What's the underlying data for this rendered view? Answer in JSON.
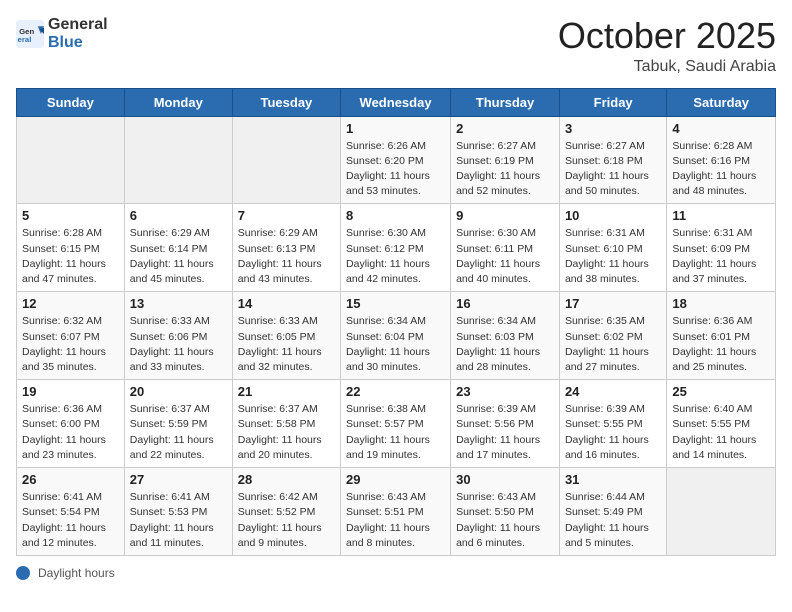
{
  "header": {
    "logo_general": "General",
    "logo_blue": "Blue",
    "month": "October 2025",
    "location": "Tabuk, Saudi Arabia"
  },
  "days_of_week": [
    "Sunday",
    "Monday",
    "Tuesday",
    "Wednesday",
    "Thursday",
    "Friday",
    "Saturday"
  ],
  "weeks": [
    [
      {
        "day": "",
        "info": ""
      },
      {
        "day": "",
        "info": ""
      },
      {
        "day": "",
        "info": ""
      },
      {
        "day": "1",
        "info": "Sunrise: 6:26 AM\nSunset: 6:20 PM\nDaylight: 11 hours and 53 minutes."
      },
      {
        "day": "2",
        "info": "Sunrise: 6:27 AM\nSunset: 6:19 PM\nDaylight: 11 hours and 52 minutes."
      },
      {
        "day": "3",
        "info": "Sunrise: 6:27 AM\nSunset: 6:18 PM\nDaylight: 11 hours and 50 minutes."
      },
      {
        "day": "4",
        "info": "Sunrise: 6:28 AM\nSunset: 6:16 PM\nDaylight: 11 hours and 48 minutes."
      }
    ],
    [
      {
        "day": "5",
        "info": "Sunrise: 6:28 AM\nSunset: 6:15 PM\nDaylight: 11 hours and 47 minutes."
      },
      {
        "day": "6",
        "info": "Sunrise: 6:29 AM\nSunset: 6:14 PM\nDaylight: 11 hours and 45 minutes."
      },
      {
        "day": "7",
        "info": "Sunrise: 6:29 AM\nSunset: 6:13 PM\nDaylight: 11 hours and 43 minutes."
      },
      {
        "day": "8",
        "info": "Sunrise: 6:30 AM\nSunset: 6:12 PM\nDaylight: 11 hours and 42 minutes."
      },
      {
        "day": "9",
        "info": "Sunrise: 6:30 AM\nSunset: 6:11 PM\nDaylight: 11 hours and 40 minutes."
      },
      {
        "day": "10",
        "info": "Sunrise: 6:31 AM\nSunset: 6:10 PM\nDaylight: 11 hours and 38 minutes."
      },
      {
        "day": "11",
        "info": "Sunrise: 6:31 AM\nSunset: 6:09 PM\nDaylight: 11 hours and 37 minutes."
      }
    ],
    [
      {
        "day": "12",
        "info": "Sunrise: 6:32 AM\nSunset: 6:07 PM\nDaylight: 11 hours and 35 minutes."
      },
      {
        "day": "13",
        "info": "Sunrise: 6:33 AM\nSunset: 6:06 PM\nDaylight: 11 hours and 33 minutes."
      },
      {
        "day": "14",
        "info": "Sunrise: 6:33 AM\nSunset: 6:05 PM\nDaylight: 11 hours and 32 minutes."
      },
      {
        "day": "15",
        "info": "Sunrise: 6:34 AM\nSunset: 6:04 PM\nDaylight: 11 hours and 30 minutes."
      },
      {
        "day": "16",
        "info": "Sunrise: 6:34 AM\nSunset: 6:03 PM\nDaylight: 11 hours and 28 minutes."
      },
      {
        "day": "17",
        "info": "Sunrise: 6:35 AM\nSunset: 6:02 PM\nDaylight: 11 hours and 27 minutes."
      },
      {
        "day": "18",
        "info": "Sunrise: 6:36 AM\nSunset: 6:01 PM\nDaylight: 11 hours and 25 minutes."
      }
    ],
    [
      {
        "day": "19",
        "info": "Sunrise: 6:36 AM\nSunset: 6:00 PM\nDaylight: 11 hours and 23 minutes."
      },
      {
        "day": "20",
        "info": "Sunrise: 6:37 AM\nSunset: 5:59 PM\nDaylight: 11 hours and 22 minutes."
      },
      {
        "day": "21",
        "info": "Sunrise: 6:37 AM\nSunset: 5:58 PM\nDaylight: 11 hours and 20 minutes."
      },
      {
        "day": "22",
        "info": "Sunrise: 6:38 AM\nSunset: 5:57 PM\nDaylight: 11 hours and 19 minutes."
      },
      {
        "day": "23",
        "info": "Sunrise: 6:39 AM\nSunset: 5:56 PM\nDaylight: 11 hours and 17 minutes."
      },
      {
        "day": "24",
        "info": "Sunrise: 6:39 AM\nSunset: 5:55 PM\nDaylight: 11 hours and 16 minutes."
      },
      {
        "day": "25",
        "info": "Sunrise: 6:40 AM\nSunset: 5:55 PM\nDaylight: 11 hours and 14 minutes."
      }
    ],
    [
      {
        "day": "26",
        "info": "Sunrise: 6:41 AM\nSunset: 5:54 PM\nDaylight: 11 hours and 12 minutes."
      },
      {
        "day": "27",
        "info": "Sunrise: 6:41 AM\nSunset: 5:53 PM\nDaylight: 11 hours and 11 minutes."
      },
      {
        "day": "28",
        "info": "Sunrise: 6:42 AM\nSunset: 5:52 PM\nDaylight: 11 hours and 9 minutes."
      },
      {
        "day": "29",
        "info": "Sunrise: 6:43 AM\nSunset: 5:51 PM\nDaylight: 11 hours and 8 minutes."
      },
      {
        "day": "30",
        "info": "Sunrise: 6:43 AM\nSunset: 5:50 PM\nDaylight: 11 hours and 6 minutes."
      },
      {
        "day": "31",
        "info": "Sunrise: 6:44 AM\nSunset: 5:49 PM\nDaylight: 11 hours and 5 minutes."
      },
      {
        "day": "",
        "info": ""
      }
    ]
  ],
  "footer": {
    "daylight_label": "Daylight hours"
  }
}
